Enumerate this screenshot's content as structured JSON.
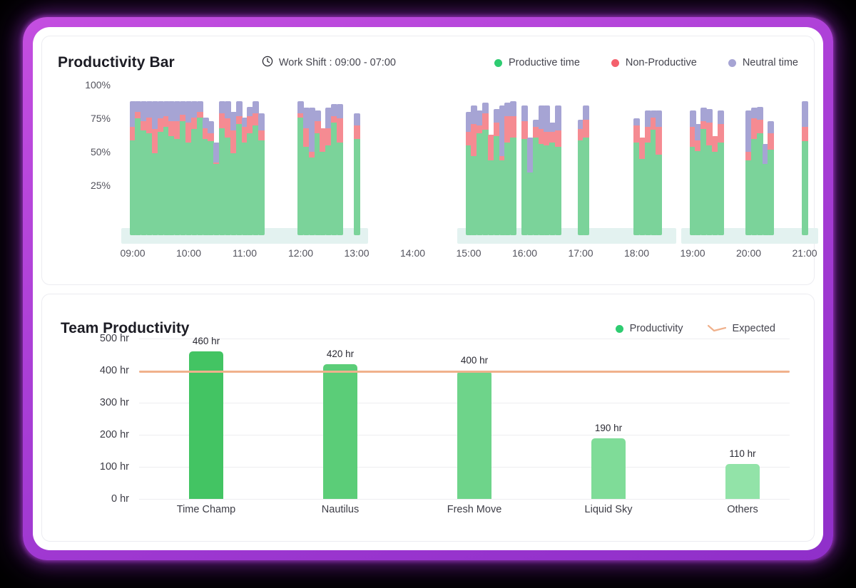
{
  "theme": {
    "frame_color": "#a93ed6",
    "page_background": "#000000",
    "card_background": "#ffffff"
  },
  "productivity_bar": {
    "title": "Productivity Bar",
    "shift": {
      "icon": "clock-icon",
      "label": "Work Shift : 09:00 - 07:00"
    },
    "legend": [
      {
        "label": "Productive time",
        "color": "#2ecc71"
      },
      {
        "label": "Non-Productive",
        "color": "#f4606c"
      },
      {
        "label": "Neutral time",
        "color": "#a6a4d4"
      }
    ],
    "chart_data": {
      "type": "bar",
      "title": "Productivity Bar",
      "xlabel": "",
      "ylabel": "",
      "ylim": [
        0,
        100
      ],
      "ytick_labels": [
        "100%",
        "75%",
        "50%",
        "25%"
      ],
      "ytick_values": [
        100,
        75,
        50,
        25
      ],
      "xtick_labels": [
        "09:00",
        "10:00",
        "11:00",
        "12:00",
        "13:00",
        "14:00",
        "15:00",
        "16:00",
        "17:00",
        "18:00",
        "19:00",
        "20:00",
        "21:00"
      ],
      "grid": false,
      "legend_position": "top-right",
      "stacked": true,
      "series": [
        {
          "name": "Productive time",
          "color": "#7bd39a"
        },
        {
          "name": "Non-Productive",
          "color": "#f58b92"
        },
        {
          "name": "Neutral time",
          "color": "#a6a4d4"
        }
      ],
      "bars": [
        {
          "t": "09:00",
          "productive": 71,
          "nonproductive": 10,
          "neutral": 19
        },
        {
          "t": "09:06",
          "productive": 87,
          "nonproductive": 5,
          "neutral": 8
        },
        {
          "t": "09:12",
          "productive": 78,
          "nonproductive": 7,
          "neutral": 15
        },
        {
          "t": "09:18",
          "productive": 76,
          "nonproductive": 12,
          "neutral": 12
        },
        {
          "t": "09:24",
          "productive": 61,
          "nonproductive": 18,
          "neutral": 21
        },
        {
          "t": "09:30",
          "productive": 77,
          "nonproductive": 10,
          "neutral": 13
        },
        {
          "t": "09:36",
          "productive": 81,
          "nonproductive": 8,
          "neutral": 11
        },
        {
          "t": "09:42",
          "productive": 74,
          "nonproductive": 11,
          "neutral": 15
        },
        {
          "t": "09:48",
          "productive": 72,
          "nonproductive": 13,
          "neutral": 15
        },
        {
          "t": "09:54",
          "productive": 85,
          "nonproductive": 5,
          "neutral": 10
        },
        {
          "t": "10:00",
          "productive": 69,
          "nonproductive": 15,
          "neutral": 16
        },
        {
          "t": "10:06",
          "productive": 79,
          "nonproductive": 9,
          "neutral": 12
        },
        {
          "t": "10:12",
          "productive": 88,
          "nonproductive": 4,
          "neutral": 8
        },
        {
          "t": "10:18",
          "productive": 72,
          "nonproductive": 8,
          "neutral": 8
        },
        {
          "t": "10:24",
          "productive": 70,
          "nonproductive": 6,
          "neutral": 9
        },
        {
          "t": "10:30",
          "productive": 53,
          "nonproductive": 1,
          "neutral": 15
        },
        {
          "t": "10:36",
          "productive": 80,
          "nonproductive": 11,
          "neutral": 9
        },
        {
          "t": "10:42",
          "productive": 73,
          "nonproductive": 14,
          "neutral": 13
        },
        {
          "t": "10:48",
          "productive": 61,
          "nonproductive": 17,
          "neutral": 14
        },
        {
          "t": "10:54",
          "productive": 83,
          "nonproductive": 6,
          "neutral": 11
        },
        {
          "t": "11:00",
          "productive": 69,
          "nonproductive": 12,
          "neutral": 7
        },
        {
          "t": "11:06",
          "productive": 76,
          "nonproductive": 13,
          "neutral": 7
        },
        {
          "t": "11:12",
          "productive": 82,
          "nonproductive": 9,
          "neutral": 9
        },
        {
          "t": "11:18",
          "productive": 71,
          "nonproductive": 7,
          "neutral": 13
        },
        {
          "t": "12:00",
          "productive": 88,
          "nonproductive": 3,
          "neutral": 9
        },
        {
          "t": "12:06",
          "productive": 66,
          "nonproductive": 14,
          "neutral": 15
        },
        {
          "t": "12:12",
          "productive": 58,
          "nonproductive": 4,
          "neutral": 33
        },
        {
          "t": "12:18",
          "productive": 76,
          "nonproductive": 9,
          "neutral": 8
        },
        {
          "t": "12:24",
          "productive": 62,
          "nonproductive": 18,
          "neutral": 0
        },
        {
          "t": "12:30",
          "productive": 67,
          "nonproductive": 13,
          "neutral": 15
        },
        {
          "t": "12:36",
          "productive": 84,
          "nonproductive": 5,
          "neutral": 9
        },
        {
          "t": "12:42",
          "productive": 69,
          "nonproductive": 18,
          "neutral": 11
        },
        {
          "t": "13:00",
          "productive": 72,
          "nonproductive": 10,
          "neutral": 9
        },
        {
          "t": "15:00",
          "productive": 67,
          "nonproductive": 10,
          "neutral": 15
        },
        {
          "t": "15:06",
          "productive": 59,
          "nonproductive": 24,
          "neutral": 14
        },
        {
          "t": "15:12",
          "productive": 76,
          "nonproductive": 6,
          "neutral": 11
        },
        {
          "t": "15:18",
          "productive": 79,
          "nonproductive": 12,
          "neutral": 8
        },
        {
          "t": "15:24",
          "productive": 56,
          "nonproductive": 19,
          "neutral": 0
        },
        {
          "t": "15:30",
          "productive": 74,
          "nonproductive": 10,
          "neutral": 10
        },
        {
          "t": "15:36",
          "productive": 56,
          "nonproductive": 3,
          "neutral": 38
        },
        {
          "t": "15:42",
          "productive": 69,
          "nonproductive": 20,
          "neutral": 10
        },
        {
          "t": "15:48",
          "productive": 73,
          "nonproductive": 16,
          "neutral": 11
        },
        {
          "t": "16:00",
          "productive": 72,
          "nonproductive": 13,
          "neutral": 12
        },
        {
          "t": "16:06",
          "productive": 47,
          "nonproductive": 0,
          "neutral": 26
        },
        {
          "t": "16:12",
          "productive": 73,
          "nonproductive": 8,
          "neutral": 5
        },
        {
          "t": "16:18",
          "productive": 68,
          "nonproductive": 11,
          "neutral": 18
        },
        {
          "t": "16:24",
          "productive": 67,
          "nonproductive": 10,
          "neutral": 20
        },
        {
          "t": "16:30",
          "productive": 69,
          "nonproductive": 8,
          "neutral": 7
        },
        {
          "t": "16:36",
          "productive": 66,
          "nonproductive": 12,
          "neutral": 19
        },
        {
          "t": "17:00",
          "productive": 71,
          "nonproductive": 8,
          "neutral": 7
        },
        {
          "t": "17:06",
          "productive": 73,
          "nonproductive": 13,
          "neutral": 11
        },
        {
          "t": "18:00",
          "productive": 69,
          "nonproductive": 13,
          "neutral": 5
        },
        {
          "t": "18:06",
          "productive": 57,
          "nonproductive": 16,
          "neutral": 0
        },
        {
          "t": "18:12",
          "productive": 69,
          "nonproductive": 12,
          "neutral": 12
        },
        {
          "t": "18:18",
          "productive": 79,
          "nonproductive": 9,
          "neutral": 5
        },
        {
          "t": "18:24",
          "productive": 60,
          "nonproductive": 21,
          "neutral": 12
        },
        {
          "t": "19:00",
          "productive": 66,
          "nonproductive": 15,
          "neutral": 12
        },
        {
          "t": "19:06",
          "productive": 63,
          "nonproductive": 8,
          "neutral": 12
        },
        {
          "t": "19:12",
          "productive": 79,
          "nonproductive": 6,
          "neutral": 10
        },
        {
          "t": "19:18",
          "productive": 67,
          "nonproductive": 17,
          "neutral": 10
        },
        {
          "t": "19:24",
          "productive": 62,
          "nonproductive": 12,
          "neutral": 0
        },
        {
          "t": "19:30",
          "productive": 69,
          "nonproductive": 14,
          "neutral": 10
        },
        {
          "t": "20:00",
          "productive": 56,
          "nonproductive": 6,
          "neutral": 31
        },
        {
          "t": "20:06",
          "productive": 72,
          "nonproductive": 15,
          "neutral": 8
        },
        {
          "t": "20:12",
          "productive": 76,
          "nonproductive": 10,
          "neutral": 10
        },
        {
          "t": "20:18",
          "productive": 53,
          "nonproductive": 0,
          "neutral": 15
        },
        {
          "t": "20:24",
          "productive": 64,
          "nonproductive": 12,
          "neutral": 9
        },
        {
          "t": "21:00",
          "productive": 70,
          "nonproductive": 11,
          "neutral": 19
        }
      ],
      "groups": [
        {
          "start": "09:00",
          "end": "13:00"
        },
        {
          "start": "15:00",
          "end": "17:00"
        },
        {
          "start": "18:00",
          "end": "19:00"
        },
        {
          "start": "19:00",
          "end": "21:00"
        }
      ]
    }
  },
  "team_productivity": {
    "title": "Team Productivity",
    "legend": [
      {
        "label": "Productivity",
        "color": "#2ecc71",
        "marker": "dot"
      },
      {
        "label": "Expected",
        "color": "#f0b18c",
        "marker": "line"
      }
    ],
    "chart_data": {
      "type": "bar",
      "title": "Team Productivity",
      "xlabel": "",
      "ylabel": "hr",
      "ylim": [
        0,
        500
      ],
      "ytick_labels": [
        "500 hr",
        "400 hr",
        "300 hr",
        "200 hr",
        "100 hr",
        "0 hr"
      ],
      "ytick_values": [
        500,
        400,
        300,
        200,
        100,
        0
      ],
      "grid": true,
      "legend_position": "top-right",
      "categories": [
        "Time Champ",
        "Nautilus",
        "Fresh Move",
        "Liquid Sky",
        "Others"
      ],
      "values": [
        460,
        420,
        400,
        190,
        110
      ],
      "value_labels": [
        "460 hr",
        "420 hr",
        "400 hr",
        "190 hr",
        "110 hr"
      ],
      "bar_colors": [
        "#43c463",
        "#5bcd78",
        "#6ed48a",
        "#7fdc98",
        "#92e3a8"
      ],
      "expected_line": {
        "name": "Expected",
        "value": 400,
        "color": "#f0b18c"
      }
    }
  }
}
